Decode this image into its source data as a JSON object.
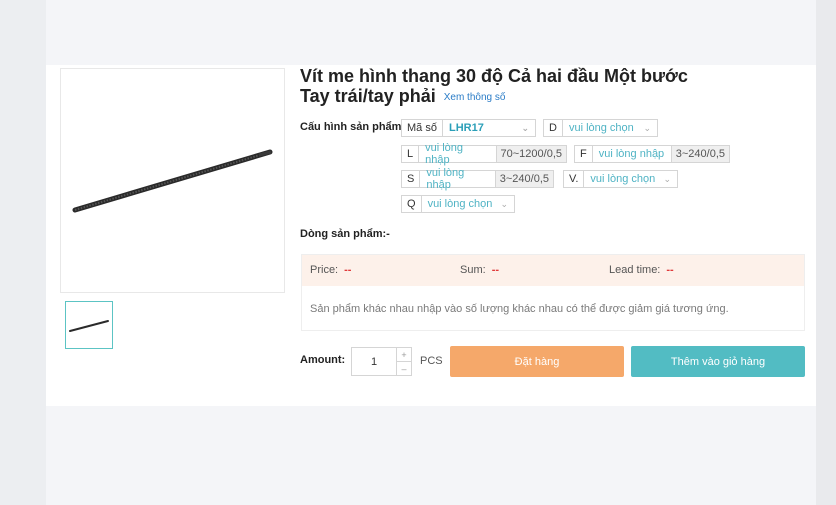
{
  "product": {
    "title_line1": "Vít me hình thang 30 độ Cả hai đầu Một bước",
    "title_line2": "Tay trái/tay phải",
    "spec_link": "Xem thông số"
  },
  "config": {
    "label": "Cấu hình sản phẩm:",
    "fields": [
      {
        "code": "Mã số",
        "value": "LHR17",
        "range": ""
      },
      {
        "code": "D",
        "value": "vui lòng chọn",
        "range": ""
      },
      {
        "code": "L",
        "value": "vui lòng nhập",
        "range": "70~1200/0,5"
      },
      {
        "code": "F",
        "value": "vui lòng nhập",
        "range": "3~240/0,5"
      },
      {
        "code": "S",
        "value": "vui lòng nhập",
        "range": "3~240/0,5"
      },
      {
        "code": "V.",
        "value": "vui lòng chọn",
        "range": ""
      },
      {
        "code": "Q",
        "value": "vui lòng chọn",
        "range": ""
      }
    ]
  },
  "series": {
    "label": "Dòng sản phẩm:",
    "value": "-"
  },
  "pricing": {
    "price_label": "Price:",
    "price_value": "--",
    "sum_label": "Sum:",
    "sum_value": "--",
    "lead_label": "Lead time:",
    "lead_value": "--",
    "note": "Sản phẩm khác nhau nhập vào số lượng khác nhau có thể được giảm giá tương ứng."
  },
  "order": {
    "amount_label": "Amount:",
    "quantity": "1",
    "unit": "PCS",
    "order_button": "Đặt hàng",
    "cart_button": "Thêm vào giỏ hàng"
  },
  "icons": {
    "plus": "plus-icon",
    "minus": "minus-icon",
    "chevron": "chevron-down-icon"
  },
  "colors": {
    "accent": "#52bcc3",
    "order": "#f5a86a",
    "price_dash": "#e03b3b",
    "link": "#2a7cc7"
  }
}
